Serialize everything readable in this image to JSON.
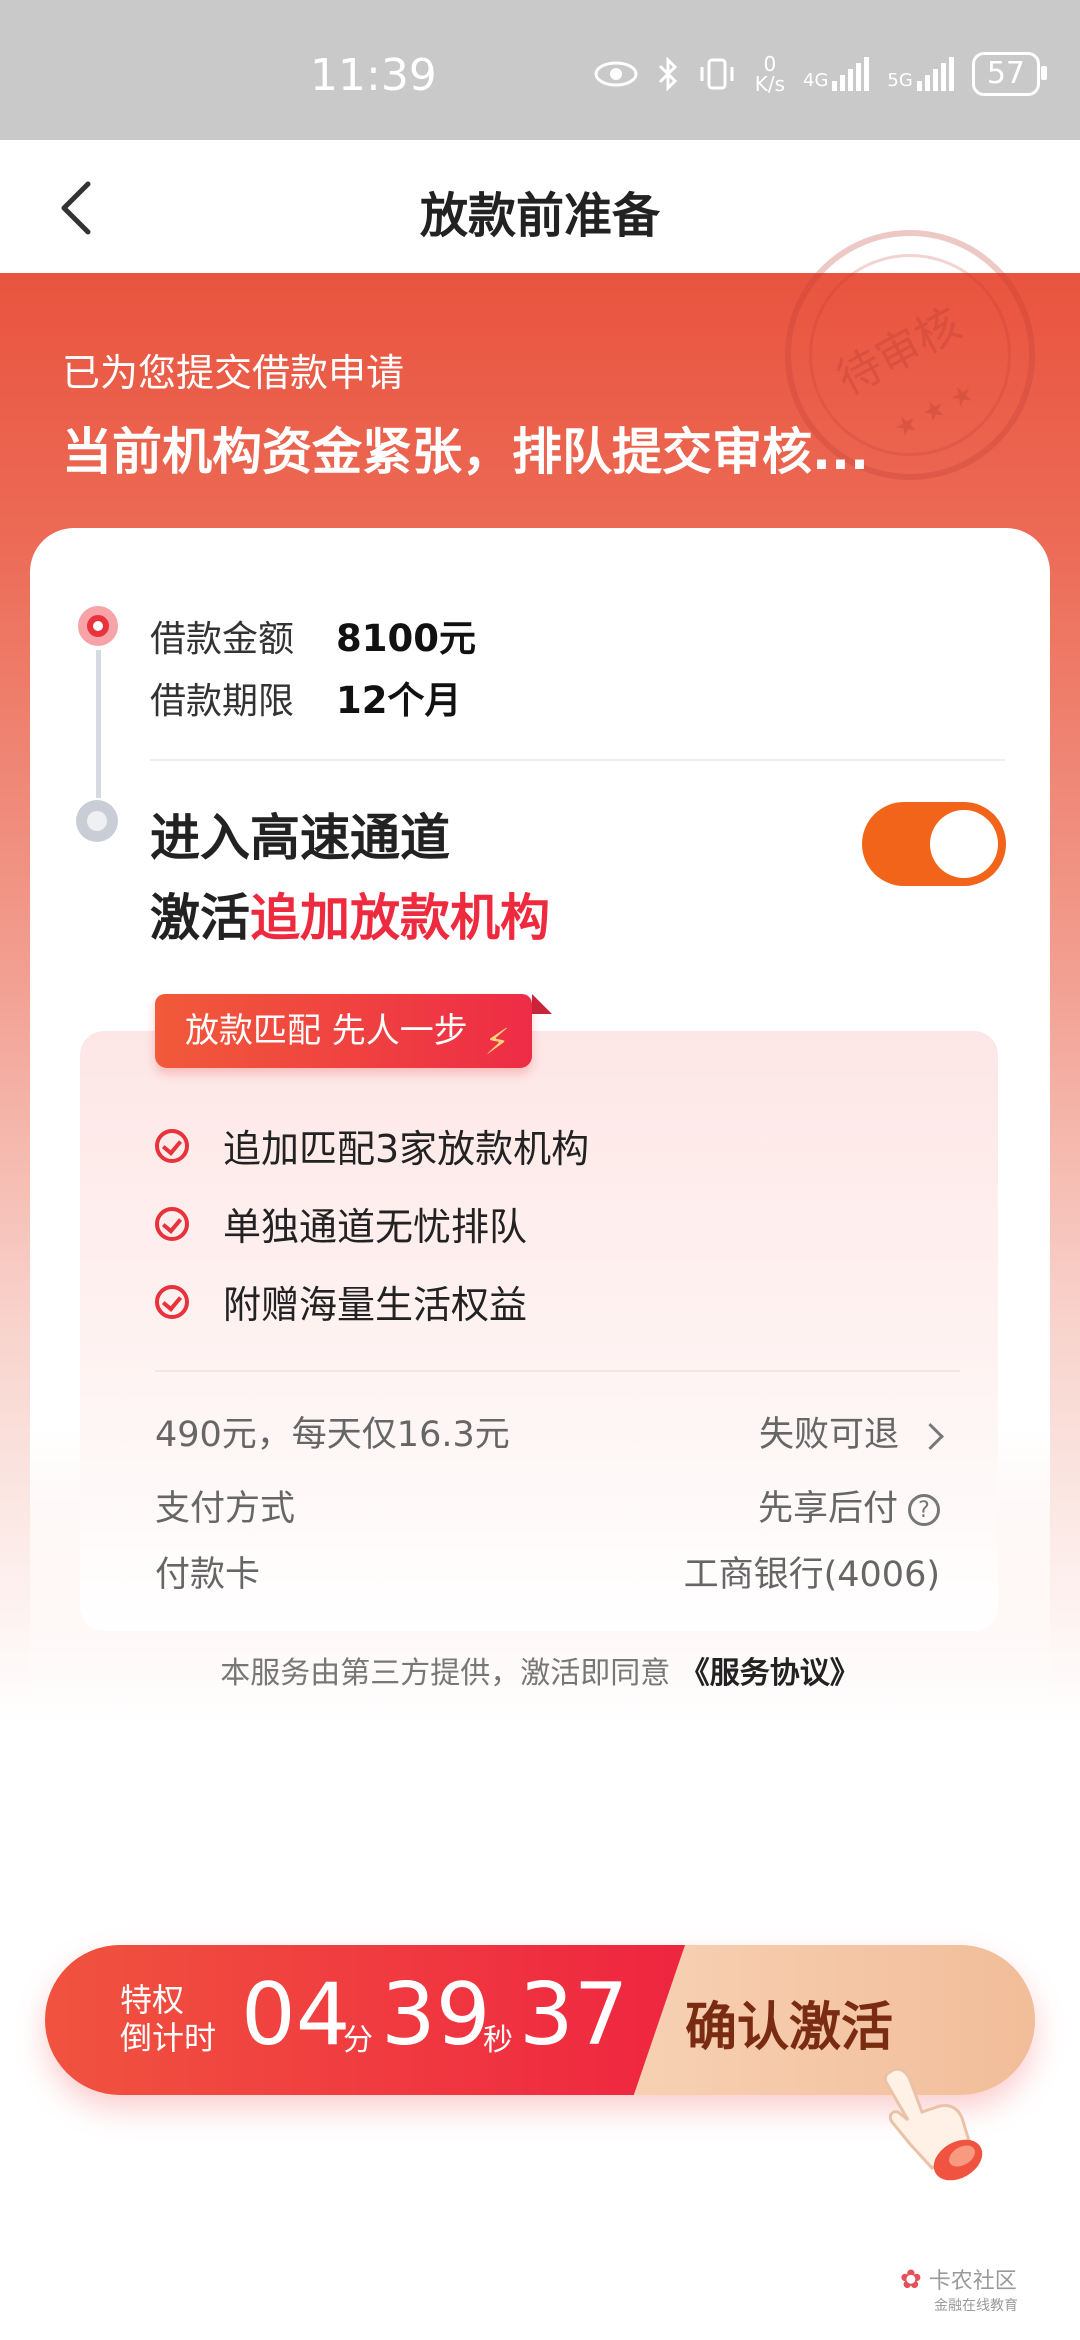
{
  "status_bar": {
    "time": "11:39",
    "net_speed_top": "0",
    "net_speed_unit": "K/s",
    "net1": "4G",
    "net2": "5G",
    "battery": "57",
    "icons": [
      "eye-icon",
      "bluetooth-icon",
      "vibrate-icon",
      "signal-icon",
      "battery-icon"
    ]
  },
  "nav": {
    "title": "放款前准备"
  },
  "hero": {
    "subtitle": "已为您提交借款申请",
    "title": "当前机构资金紧张，排队提交审核...",
    "stamp_text": "待审核",
    "stamp_stars": "★ ★ ★"
  },
  "loan": {
    "amount_label": "借款金额",
    "amount_value": "8100元",
    "term_label": "借款期限",
    "term_value": "12个月"
  },
  "channel": {
    "line1": "进入高速通道",
    "line2_prefix": "激活",
    "line2_highlight": "追加放款机构",
    "toggle_on": true
  },
  "benefits": {
    "tag": "放款匹配 先人一步",
    "items": [
      "追加匹配3家放款机构",
      "单独通道无忧排队",
      "附赠海量生活权益"
    ]
  },
  "details": {
    "price_text": "490元，每天仅16.3元",
    "refund_text": "失败可退",
    "pay_method_label": "支付方式",
    "pay_method_value": "先享后付",
    "card_label": "付款卡",
    "card_value": "工商银行(4006)"
  },
  "agreement": {
    "text": "本服务由第三方提供，激活即同意",
    "link": "《服务协议》"
  },
  "action": {
    "label_line1": "特权",
    "label_line2": "倒计时",
    "minutes": "04",
    "min_unit": "分",
    "seconds": "39",
    "sec_unit": "秒",
    "millis": "37",
    "confirm": "确认激活"
  },
  "watermark": {
    "text": "卡农社区",
    "sub": "金融在线教育"
  },
  "colors": {
    "accent": "#ee2a3e",
    "toggle": "#f2641a",
    "hero": "#e9543f"
  }
}
